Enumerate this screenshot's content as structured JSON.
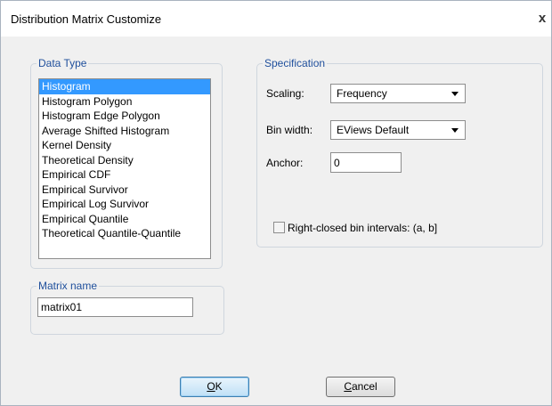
{
  "dialog": {
    "title": "Distribution Matrix Customize",
    "close_label": "x"
  },
  "data_type": {
    "legend": "Data Type",
    "items": [
      "Histogram",
      "Histogram Polygon",
      "Histogram Edge Polygon",
      "Average Shifted Histogram",
      "Kernel Density",
      "Theoretical Density",
      "Empirical CDF",
      "Empirical Survivor",
      "Empirical Log Survivor",
      "Empirical Quantile",
      "Theoretical Quantile-Quantile"
    ],
    "selected": "Histogram"
  },
  "specification": {
    "legend": "Specification",
    "scaling_label": "Scaling:",
    "scaling_value": "Frequency",
    "bin_width_label": "Bin width:",
    "bin_width_value": "EViews Default",
    "anchor_label": "Anchor:",
    "anchor_value": "0",
    "right_closed_label": "Right-closed bin intervals: (a, b]",
    "right_closed_checked": false
  },
  "matrix": {
    "legend": "Matrix name",
    "value": "matrix01"
  },
  "buttons": {
    "ok_accel": "O",
    "ok_rest": "K",
    "cancel_accel": "C",
    "cancel_rest": "ancel"
  }
}
